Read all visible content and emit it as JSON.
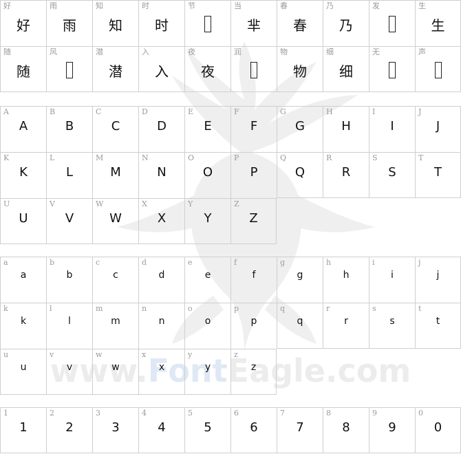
{
  "watermark": {
    "prefix": "www.",
    "accent": "Font",
    "suffix": "Eagle.com"
  },
  "sections": [
    {
      "id": "chinese",
      "rows": [
        [
          {
            "ref": "好",
            "glyph": "好"
          },
          {
            "ref": "雨",
            "glyph": "雨"
          },
          {
            "ref": "知",
            "glyph": "知"
          },
          {
            "ref": "时",
            "glyph": "时"
          },
          {
            "ref": "节",
            "glyph": null
          },
          {
            "ref": "当",
            "glyph": "芈"
          },
          {
            "ref": "春",
            "glyph": "春"
          },
          {
            "ref": "乃",
            "glyph": "乃"
          },
          {
            "ref": "发",
            "glyph": null
          },
          {
            "ref": "生",
            "glyph": "生"
          }
        ],
        [
          {
            "ref": "随",
            "glyph": "随"
          },
          {
            "ref": "风",
            "glyph": null
          },
          {
            "ref": "潜",
            "glyph": "潜"
          },
          {
            "ref": "入",
            "glyph": "入"
          },
          {
            "ref": "夜",
            "glyph": "夜"
          },
          {
            "ref": "润",
            "glyph": null
          },
          {
            "ref": "物",
            "glyph": "物"
          },
          {
            "ref": "细",
            "glyph": "细"
          },
          {
            "ref": "无",
            "glyph": null
          },
          {
            "ref": "声",
            "glyph": null
          }
        ]
      ]
    },
    {
      "id": "uppercase",
      "rows": [
        [
          {
            "ref": "A",
            "glyph": "A"
          },
          {
            "ref": "B",
            "glyph": "B"
          },
          {
            "ref": "C",
            "glyph": "C"
          },
          {
            "ref": "D",
            "glyph": "D"
          },
          {
            "ref": "E",
            "glyph": "E"
          },
          {
            "ref": "F",
            "glyph": "F"
          },
          {
            "ref": "G",
            "glyph": "G"
          },
          {
            "ref": "H",
            "glyph": "H"
          },
          {
            "ref": "I",
            "glyph": "I"
          },
          {
            "ref": "J",
            "glyph": "J"
          }
        ],
        [
          {
            "ref": "K",
            "glyph": "K"
          },
          {
            "ref": "L",
            "glyph": "L"
          },
          {
            "ref": "M",
            "glyph": "M"
          },
          {
            "ref": "N",
            "glyph": "N"
          },
          {
            "ref": "O",
            "glyph": "O"
          },
          {
            "ref": "P",
            "glyph": "P"
          },
          {
            "ref": "Q",
            "glyph": "Q"
          },
          {
            "ref": "R",
            "glyph": "R"
          },
          {
            "ref": "S",
            "glyph": "S"
          },
          {
            "ref": "T",
            "glyph": "T"
          }
        ],
        [
          {
            "ref": "U",
            "glyph": "U"
          },
          {
            "ref": "V",
            "glyph": "V"
          },
          {
            "ref": "W",
            "glyph": "W"
          },
          {
            "ref": "X",
            "glyph": "X"
          },
          {
            "ref": "Y",
            "glyph": "Y"
          },
          {
            "ref": "Z",
            "glyph": "Z"
          }
        ]
      ]
    },
    {
      "id": "lowercase",
      "rows": [
        [
          {
            "ref": "a",
            "glyph": "a"
          },
          {
            "ref": "b",
            "glyph": "b"
          },
          {
            "ref": "c",
            "glyph": "c"
          },
          {
            "ref": "d",
            "glyph": "d"
          },
          {
            "ref": "e",
            "glyph": "e"
          },
          {
            "ref": "f",
            "glyph": "f"
          },
          {
            "ref": "g",
            "glyph": "g"
          },
          {
            "ref": "h",
            "glyph": "h"
          },
          {
            "ref": "i",
            "glyph": "i"
          },
          {
            "ref": "j",
            "glyph": "j"
          }
        ],
        [
          {
            "ref": "k",
            "glyph": "k"
          },
          {
            "ref": "l",
            "glyph": "l"
          },
          {
            "ref": "m",
            "glyph": "m"
          },
          {
            "ref": "n",
            "glyph": "n"
          },
          {
            "ref": "o",
            "glyph": "o"
          },
          {
            "ref": "p",
            "glyph": "p"
          },
          {
            "ref": "q",
            "glyph": "q"
          },
          {
            "ref": "r",
            "glyph": "r"
          },
          {
            "ref": "s",
            "glyph": "s"
          },
          {
            "ref": "t",
            "glyph": "t"
          }
        ],
        [
          {
            "ref": "u",
            "glyph": "u"
          },
          {
            "ref": "v",
            "glyph": "v"
          },
          {
            "ref": "w",
            "glyph": "w"
          },
          {
            "ref": "x",
            "glyph": "x"
          },
          {
            "ref": "y",
            "glyph": "y"
          },
          {
            "ref": "z",
            "glyph": "z"
          }
        ]
      ]
    },
    {
      "id": "digits",
      "rows": [
        [
          {
            "ref": "1",
            "glyph": "1"
          },
          {
            "ref": "2",
            "glyph": "2"
          },
          {
            "ref": "3",
            "glyph": "3"
          },
          {
            "ref": "4",
            "glyph": "4"
          },
          {
            "ref": "5",
            "glyph": "5"
          },
          {
            "ref": "6",
            "glyph": "6"
          },
          {
            "ref": "7",
            "glyph": "7"
          },
          {
            "ref": "8",
            "glyph": "8"
          },
          {
            "ref": "9",
            "glyph": "9"
          },
          {
            "ref": "0",
            "glyph": "0"
          }
        ]
      ]
    }
  ]
}
